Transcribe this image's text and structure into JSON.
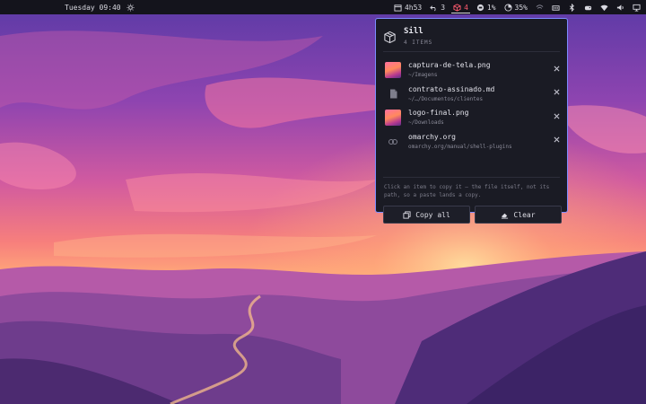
{
  "topbar": {
    "clock": "Tuesday 09:40",
    "uptime": "4h53",
    "updates": "3",
    "clipboard_count": "4",
    "cpu": "1%",
    "battery": "35%"
  },
  "panel": {
    "title": "Sill",
    "count": "4 ITEMS",
    "items": [
      {
        "name": "captura-de-tela.png",
        "path": "~/Imagens",
        "kind": "image"
      },
      {
        "name": "contrato-assinado.md",
        "path": "~/…/Documentos/clientes",
        "kind": "file"
      },
      {
        "name": "logo-final.png",
        "path": "~/Downloads",
        "kind": "image"
      },
      {
        "name": "omarchy.org",
        "path": "omarchy.org/manual/shell-plugins",
        "kind": "link"
      }
    ],
    "hint": "Click an item to copy it — the file itself, not its path, so a paste lands a copy.",
    "copy_all": "Copy all",
    "clear": "Clear"
  },
  "colors": {
    "accent": "#7c8cff",
    "panel_bg": "#1a1b24",
    "clipboard_badge": "#ff5a6e"
  }
}
